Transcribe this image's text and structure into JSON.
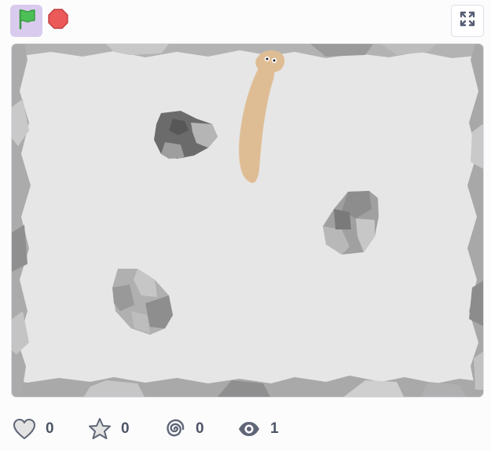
{
  "toolbar": {
    "green_flag_icon": "green-flag-icon",
    "stop_icon": "stop-sign-icon",
    "fullscreen_icon": "fullscreen-icon",
    "colors": {
      "flag_bg": "#d9cbee",
      "flag": "#4cbf56",
      "stop": "#ec5959"
    }
  },
  "stage": {
    "background": "#e6e6e6",
    "sprites": [
      "worm",
      "rock-dark",
      "rock-right",
      "rock-bottom-left"
    ],
    "colors": {
      "worm": "#dfbd94",
      "rock_dark": "#6b6b6b",
      "rock_light": "#bfbfbf",
      "border_rocks": "#a6a6a6"
    }
  },
  "stats": {
    "loves": {
      "icon": "heart-icon",
      "count": "0"
    },
    "favorites": {
      "icon": "star-icon",
      "count": "0"
    },
    "remixes": {
      "icon": "remix-spiral-icon",
      "count": "0"
    },
    "views": {
      "icon": "eye-icon",
      "count": "1"
    }
  }
}
